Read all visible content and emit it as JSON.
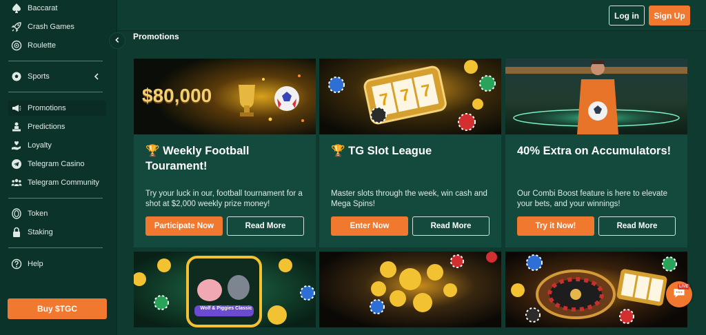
{
  "sidebar": {
    "items": [
      {
        "label": "Baccarat",
        "icon": "spade-icon"
      },
      {
        "label": "Crash Games",
        "icon": "rocket-icon"
      },
      {
        "label": "Roulette",
        "icon": "roulette-icon"
      },
      {
        "label": "Sports",
        "icon": "soccer-ball-icon"
      },
      {
        "label": "Promotions",
        "icon": "megaphone-icon"
      },
      {
        "label": "Predictions",
        "icon": "predictions-icon"
      },
      {
        "label": "Loyalty",
        "icon": "heart-hand-icon"
      },
      {
        "label": "Telegram Casino",
        "icon": "telegram-icon"
      },
      {
        "label": "Telegram Community",
        "icon": "community-icon"
      },
      {
        "label": "Token",
        "icon": "token-icon"
      },
      {
        "label": "Staking",
        "icon": "lock-icon"
      },
      {
        "label": "Help",
        "icon": "help-icon"
      }
    ],
    "buy_label": "Buy $TGC"
  },
  "header": {
    "login_label": "Log in",
    "signup_label": "Sign Up"
  },
  "main": {
    "title": "Promotions",
    "cards": [
      {
        "banner_text": "$80,000",
        "title": "🏆 Weekly Football Tourament!",
        "description": "Try your luck in our, football tournament for a shot at $2,000 weekly prize money!",
        "primary_label": "Participate Now",
        "secondary_label": "Read More"
      },
      {
        "title": "🏆 TG Slot League",
        "description": "Master slots through the week, win cash and Mega Spins!",
        "primary_label": "Enter Now",
        "secondary_label": "Read More"
      },
      {
        "title": "40% Extra on Accumulators!",
        "description": "Our Combi Boost feature is here to elevate your bets, and your winnings!",
        "primary_label": "Try it Now!",
        "secondary_label": "Read More"
      }
    ],
    "bottom_cards": [
      {
        "game_logo": "Wolf & Piggies Classic"
      },
      {},
      {}
    ]
  },
  "chat": {
    "badge": "LIVE"
  },
  "colors": {
    "accent": "#f0782f",
    "background": "#0f3a30",
    "sidebar": "#0c332a",
    "card": "#134a3d"
  }
}
